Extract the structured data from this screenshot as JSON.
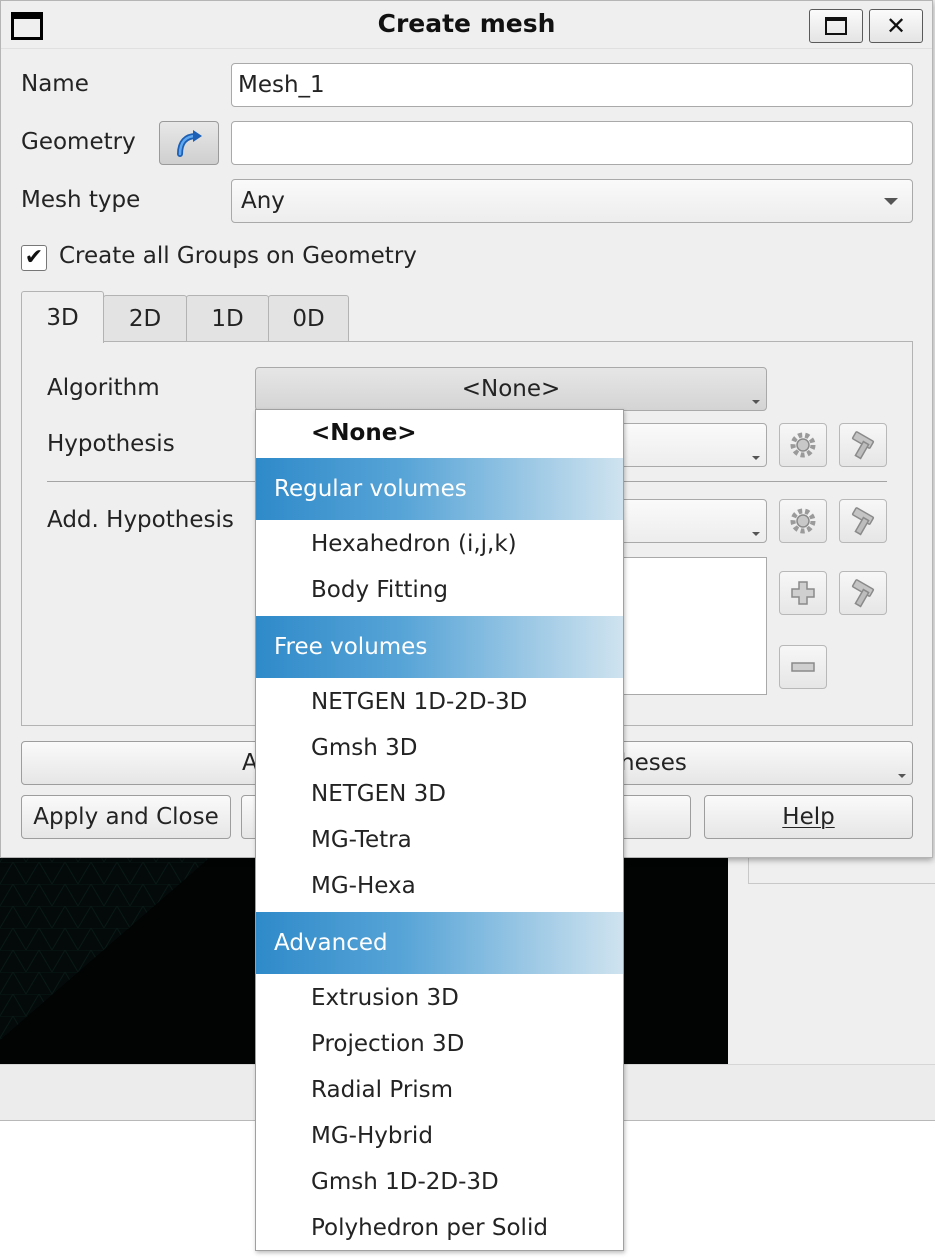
{
  "dialog": {
    "title": "Create mesh",
    "close_glyph": "✕"
  },
  "form": {
    "name_label": "Name",
    "name_value": "Mesh_1",
    "geometry_label": "Geometry",
    "geometry_value": "",
    "mesh_type_label": "Mesh type",
    "mesh_type_value": "Any",
    "create_groups_label": "Create all Groups on Geometry",
    "create_groups_checked": true,
    "check_glyph": "✔"
  },
  "tabs": [
    {
      "label": "3D",
      "active": true
    },
    {
      "label": "2D",
      "active": false
    },
    {
      "label": "1D",
      "active": false
    },
    {
      "label": "0D",
      "active": false
    }
  ],
  "panel": {
    "algorithm_label": "Algorithm",
    "algorithm_value": "<None>",
    "hypothesis_label": "Hypothesis",
    "add_hypothesis_label": "Add. Hypothesis"
  },
  "buttons": {
    "assign_hyp_left": "A",
    "assign_hyp_right": "heses",
    "apply_close": "Apply and Close",
    "help": "Help"
  },
  "algorithm_dropdown": {
    "items": [
      {
        "kind": "option",
        "label": "<None>",
        "bold": true
      },
      {
        "kind": "group",
        "label": "Regular volumes"
      },
      {
        "kind": "option",
        "label": "Hexahedron (i,j,k)"
      },
      {
        "kind": "option",
        "label": "Body Fitting"
      },
      {
        "kind": "group",
        "label": "Free volumes"
      },
      {
        "kind": "option",
        "label": "NETGEN 1D-2D-3D"
      },
      {
        "kind": "option",
        "label": "Gmsh 3D"
      },
      {
        "kind": "option",
        "label": "NETGEN 3D"
      },
      {
        "kind": "option",
        "label": "MG-Tetra"
      },
      {
        "kind": "option",
        "label": "MG-Hexa"
      },
      {
        "kind": "group",
        "label": "Advanced"
      },
      {
        "kind": "option",
        "label": "Extrusion 3D"
      },
      {
        "kind": "option",
        "label": "Projection 3D"
      },
      {
        "kind": "option",
        "label": "Radial Prism"
      },
      {
        "kind": "option",
        "label": "MG-Hybrid"
      },
      {
        "kind": "option",
        "label": "Gmsh 1D-2D-3D"
      },
      {
        "kind": "option",
        "label": "Polyhedron per Solid"
      }
    ]
  },
  "colors": {
    "group_header_start": "#2f8ac9",
    "group_header_end": "#cfe3ef",
    "viewport_bg": "#020404",
    "dialog_bg": "#efefef"
  },
  "icons": {
    "geometry_select": "curved-arrow-icon",
    "edit_hypothesis": "gear-icon",
    "create_hypothesis": "hammer-gear-icon",
    "add_hypothesis": "plus-icon",
    "remove_hypothesis": "minus-icon"
  }
}
